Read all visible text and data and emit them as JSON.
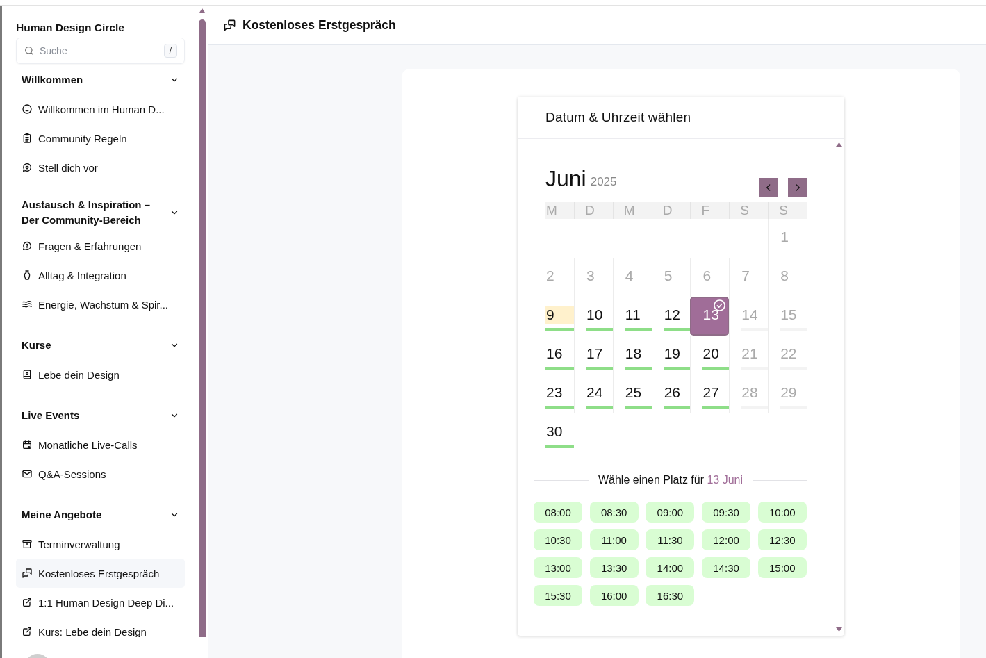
{
  "sidebar": {
    "title": "Human Design Circle",
    "search": {
      "placeholder": "Suche",
      "shortcut": "/"
    },
    "sections": [
      {
        "title": "Willkommen",
        "expanded": true,
        "items": [
          {
            "label": "Willkommen im Human D...",
            "selected": false
          },
          {
            "label": "Community Regeln",
            "selected": false
          },
          {
            "label": "Stell dich vor",
            "selected": false
          }
        ]
      },
      {
        "title": "Austausch & Inspiration – Der Community-Bereich",
        "expanded": true,
        "items": [
          {
            "label": "Fragen & Erfahrungen",
            "selected": false
          },
          {
            "label": "Alltag & Integration",
            "selected": false
          },
          {
            "label": "Energie, Wachstum & Spir...",
            "selected": false
          }
        ]
      },
      {
        "title": "Kurse",
        "expanded": true,
        "items": [
          {
            "label": "Lebe dein Design",
            "selected": false
          }
        ]
      },
      {
        "title": "Live Events",
        "expanded": true,
        "items": [
          {
            "label": "Monatliche Live-Calls",
            "selected": false
          },
          {
            "label": "Q&A-Sessions",
            "selected": false
          }
        ]
      },
      {
        "title": "Meine Angebote",
        "expanded": true,
        "items": [
          {
            "label": "Terminverwaltung",
            "selected": false
          },
          {
            "label": "Kostenloses Erstgespräch",
            "selected": true
          },
          {
            "label": "1:1 Human Design Deep Di...",
            "selected": false
          },
          {
            "label": "Kurs: Lebe dein Design",
            "selected": false
          }
        ]
      }
    ]
  },
  "header": {
    "title": "Kostenloses Erstgespräch"
  },
  "booking": {
    "title": "Datum & Uhrzeit wählen",
    "month": "Juni",
    "year": "2025",
    "weekdays": [
      "M",
      "D",
      "M",
      "D",
      "F",
      "S",
      "S"
    ],
    "weeks": [
      [
        {
          "label": "1",
          "kind": "past",
          "today": false,
          "selected": false
        }
      ],
      [
        {
          "label": "2",
          "kind": "past",
          "today": false,
          "selected": false
        },
        {
          "label": "3",
          "kind": "past",
          "today": false,
          "selected": false
        },
        {
          "label": "4",
          "kind": "past",
          "today": false,
          "selected": false
        },
        {
          "label": "5",
          "kind": "past",
          "today": false,
          "selected": false
        },
        {
          "label": "6",
          "kind": "past",
          "today": false,
          "selected": false
        },
        {
          "label": "7",
          "kind": "past",
          "today": false,
          "selected": false
        },
        {
          "label": "8",
          "kind": "past",
          "today": false,
          "selected": false
        }
      ],
      [
        {
          "label": "9",
          "kind": "open",
          "today": true,
          "selected": false
        },
        {
          "label": "10",
          "kind": "open",
          "today": false,
          "selected": false
        },
        {
          "label": "11",
          "kind": "open",
          "today": false,
          "selected": false
        },
        {
          "label": "12",
          "kind": "open",
          "today": false,
          "selected": false
        },
        {
          "label": "13",
          "kind": "open",
          "today": false,
          "selected": true
        },
        {
          "label": "14",
          "kind": "closed",
          "today": false,
          "selected": false
        },
        {
          "label": "15",
          "kind": "closed",
          "today": false,
          "selected": false
        }
      ],
      [
        {
          "label": "16",
          "kind": "open",
          "today": false,
          "selected": false
        },
        {
          "label": "17",
          "kind": "open",
          "today": false,
          "selected": false
        },
        {
          "label": "18",
          "kind": "open",
          "today": false,
          "selected": false
        },
        {
          "label": "19",
          "kind": "open",
          "today": false,
          "selected": false
        },
        {
          "label": "20",
          "kind": "open",
          "today": false,
          "selected": false
        },
        {
          "label": "21",
          "kind": "closed",
          "today": false,
          "selected": false
        },
        {
          "label": "22",
          "kind": "closed",
          "today": false,
          "selected": false
        }
      ],
      [
        {
          "label": "23",
          "kind": "open",
          "today": false,
          "selected": false
        },
        {
          "label": "24",
          "kind": "open",
          "today": false,
          "selected": false
        },
        {
          "label": "25",
          "kind": "open",
          "today": false,
          "selected": false
        },
        {
          "label": "26",
          "kind": "open",
          "today": false,
          "selected": false
        },
        {
          "label": "27",
          "kind": "open",
          "today": false,
          "selected": false
        },
        {
          "label": "28",
          "kind": "closed",
          "today": false,
          "selected": false
        },
        {
          "label": "29",
          "kind": "closed",
          "today": false,
          "selected": false
        }
      ],
      [
        {
          "label": "30",
          "kind": "open",
          "today": false,
          "selected": false
        }
      ]
    ],
    "slot_prompt": "Wähle einen Platz für",
    "selected_date": "13 Juni",
    "slots": [
      "08:00",
      "08:30",
      "09:00",
      "09:30",
      "10:00",
      "10:30",
      "11:00",
      "11:30",
      "12:00",
      "12:30",
      "13:00",
      "13:30",
      "14:00",
      "14:30",
      "15:00",
      "15:30",
      "16:00",
      "16:30"
    ]
  }
}
